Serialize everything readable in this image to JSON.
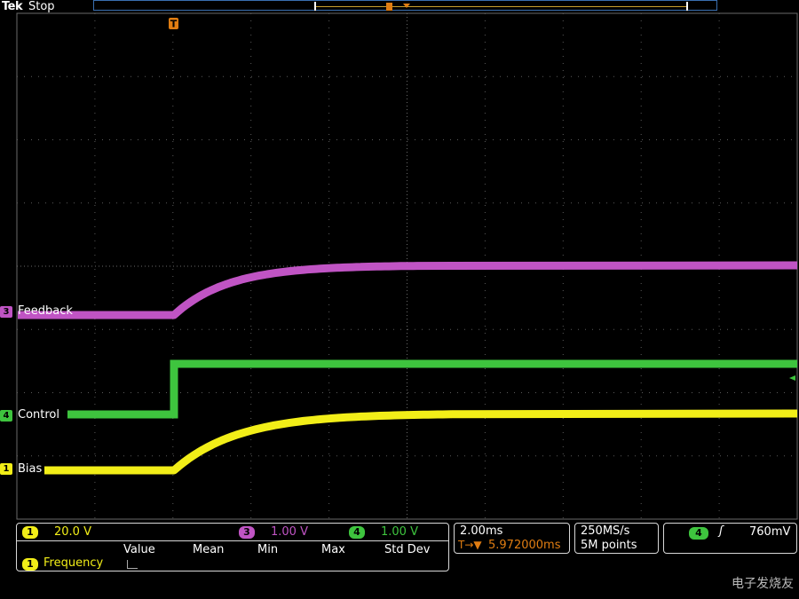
{
  "header": {
    "brand": "Tek",
    "status": "Stop"
  },
  "trigger_marker": {
    "glyph": "T"
  },
  "channels": [
    {
      "id": "3",
      "label": "Feedback",
      "color": "#c054c4"
    },
    {
      "id": "4",
      "label": "Control",
      "color": "#3ec43e"
    },
    {
      "id": "1",
      "label": "Bias",
      "color": "#f2ee18"
    }
  ],
  "vertical_scales": {
    "ch1": {
      "id": "1",
      "value": "20.0 V"
    },
    "ch3": {
      "id": "3",
      "value": "1.00 V"
    },
    "ch4": {
      "id": "4",
      "value": "1.00 V"
    }
  },
  "measurements": {
    "headers": [
      "Value",
      "Mean",
      "Min",
      "Max",
      "Std Dev"
    ],
    "rows": [
      {
        "channel": "1",
        "name": "Frequency"
      }
    ]
  },
  "timebase": {
    "scale": "2.00ms",
    "position": "5.972000ms",
    "position_prefix": "T→▼"
  },
  "acquisition": {
    "rate": "250MS/s",
    "length": "5M points"
  },
  "trigger": {
    "source": "4",
    "slope": "ʃ",
    "level": "760mV"
  },
  "watermark": {
    "text": "电子发烧友"
  }
}
